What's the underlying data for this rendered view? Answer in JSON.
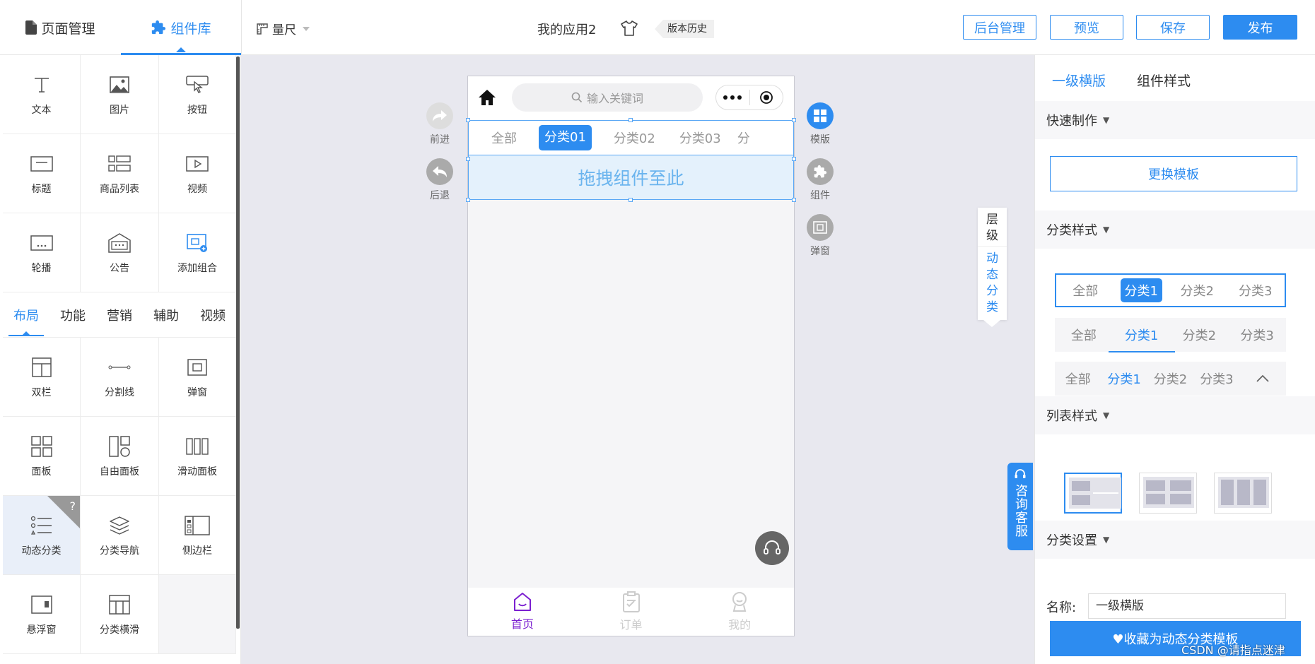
{
  "header": {
    "tab_pages": "页面管理",
    "tab_components": "组件库",
    "ruler": "量尺",
    "app_title": "我的应用2",
    "version_history": "版本历史",
    "btn_admin": "后台管理",
    "btn_preview": "预览",
    "btn_save": "保存",
    "btn_publish": "发布"
  },
  "components": {
    "basic": [
      {
        "label": "文本",
        "icon": "text-icon"
      },
      {
        "label": "图片",
        "icon": "image-icon"
      },
      {
        "label": "按钮",
        "icon": "button-icon"
      },
      {
        "label": "标题",
        "icon": "title-icon"
      },
      {
        "label": "商品列表",
        "icon": "product-list-icon"
      },
      {
        "label": "视频",
        "icon": "video-icon"
      },
      {
        "label": "轮播",
        "icon": "carousel-icon"
      },
      {
        "label": "公告",
        "icon": "notice-icon"
      },
      {
        "label": "添加组合",
        "icon": "add-group-icon"
      }
    ],
    "category_tabs": [
      "布局",
      "功能",
      "营销",
      "辅助",
      "视频"
    ],
    "layout": [
      {
        "label": "双栏",
        "icon": "two-column-icon"
      },
      {
        "label": "分割线",
        "icon": "divider-icon"
      },
      {
        "label": "弹窗",
        "icon": "popup-icon"
      },
      {
        "label": "面板",
        "icon": "panel-icon"
      },
      {
        "label": "自由面板",
        "icon": "free-panel-icon"
      },
      {
        "label": "滑动面板",
        "icon": "slide-panel-icon"
      },
      {
        "label": "动态分类",
        "icon": "dynamic-category-icon"
      },
      {
        "label": "分类导航",
        "icon": "category-nav-icon"
      },
      {
        "label": "侧边栏",
        "icon": "sidebar-icon"
      },
      {
        "label": "悬浮窗",
        "icon": "float-window-icon"
      },
      {
        "label": "分类横滑",
        "icon": "category-scroll-icon"
      }
    ],
    "help_mark": "?"
  },
  "canvas_actions": {
    "forward": "前进",
    "back": "后退",
    "template": "模版",
    "component": "组件",
    "popup": "弹窗"
  },
  "phone": {
    "search_placeholder": "输入关键词",
    "categories": [
      "全部",
      "分类01",
      "分类02",
      "分类03",
      "分"
    ],
    "drop_hint": "拖拽组件至此",
    "tabbar": [
      "首页",
      "订单",
      "我的"
    ]
  },
  "layer_panel": {
    "layer": [
      "层",
      "级"
    ],
    "dynamic": [
      "动",
      "态",
      "分",
      "类"
    ]
  },
  "consult": "咨询客服",
  "right_panel": {
    "tab_primary": "一级横版",
    "tab_style": "组件样式",
    "quick_make": "快速制作",
    "btn_change_template": "更换模板",
    "category_style": "分类样式",
    "style_options": [
      "全部",
      "分类1",
      "分类2",
      "分类3"
    ],
    "list_style": "列表样式",
    "category_settings": "分类设置",
    "name_label": "名称:",
    "name_value": "一级横版",
    "save_template": "♥收藏为动态分类模板"
  },
  "watermark": "CSDN @请指点迷津",
  "colors": {
    "accent": "#2d8cf0",
    "tabbar_active": "#7b1fd0"
  }
}
